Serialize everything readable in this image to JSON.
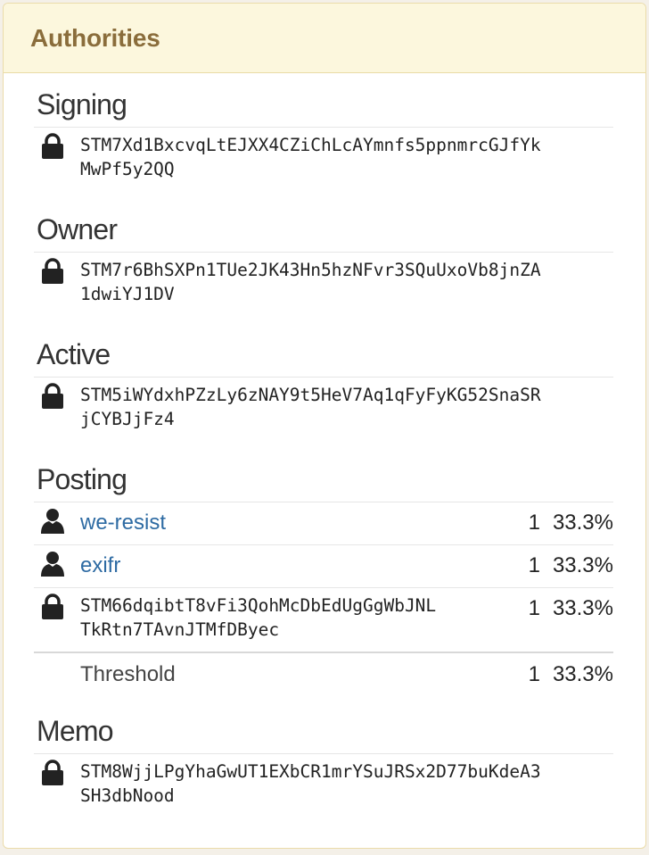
{
  "panel": {
    "title": "Authorities"
  },
  "signing": {
    "title": "Signing",
    "key_line1": "STM7Xd1BxcvqLtEJXX4CZiChLcAYmnfs5ppnmrcGJfYk",
    "key_line2": "MwPf5y2QQ"
  },
  "owner": {
    "title": "Owner",
    "key_line1": "STM7r6BhSXPn1TUe2JK43Hn5hzNFvr3SQuUxoVb8jnZA",
    "key_line2": "1dwiYJ1DV"
  },
  "active": {
    "title": "Active",
    "key_line1": "STM5iWYdxhPZzLy6zNAY9t5HeV7Aq1qFyFyKG52SnaSR",
    "key_line2": "jCYBJjFz4"
  },
  "posting": {
    "title": "Posting",
    "rows": [
      {
        "account": "we-resist",
        "weight": "1",
        "percent": "33.3%"
      },
      {
        "account": "exifr",
        "weight": "1",
        "percent": "33.3%"
      }
    ],
    "key_row": {
      "key_line1": "STM66dqibtT8vFi3QohMcDbEdUgGgWbJNL",
      "key_line2": "TkRtn7TAvnJTMfDByec",
      "weight": "1",
      "percent": "33.3%"
    },
    "threshold": {
      "label": "Threshold",
      "weight": "1",
      "percent": "33.3%"
    }
  },
  "memo": {
    "title": "Memo",
    "key_line1": "STM8WjjLPgYhaGwUT1EXbCR1mrYSuJRSx2D77buKdeA3",
    "key_line2": "SH3dbNood"
  },
  "icons": {
    "key": "lock-icon",
    "account": "user-icon"
  },
  "colors": {
    "heading_bg": "#fcf7dd",
    "heading_text": "#8a6d3b",
    "link": "#2e6ba3"
  }
}
